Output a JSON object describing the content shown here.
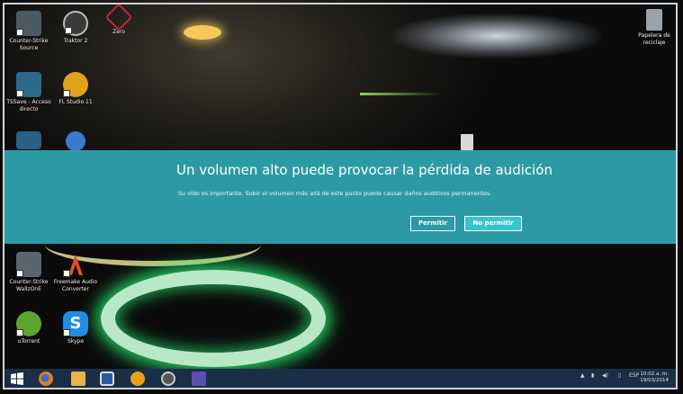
{
  "desktop": {
    "icons": [
      {
        "label": "Counter-Strike Source",
        "icon": "counter-strike-icon",
        "color": "#4d5a66"
      },
      {
        "label": "Traktor 2",
        "icon": "traktor-icon",
        "color": "#3b3b3b"
      },
      {
        "label": "Zero",
        "icon": "zero-app-icon",
        "color": "#c0273a"
      },
      {
        "label": "TSSave - Acceso directo",
        "icon": "tssave-icon",
        "color": "#6dbb3a"
      },
      {
        "label": "FL Studio 11",
        "icon": "fl-studio-icon",
        "color": "#e0a21a"
      },
      {
        "label": "Counter-Strike WallzOnE",
        "icon": "counter-strike-wallz-icon",
        "color": "#5a6570"
      },
      {
        "label": "Freemake Audio Converter",
        "icon": "freemake-icon",
        "color": "#e0502a"
      },
      {
        "label": "uTorrent",
        "icon": "utorrent-icon",
        "color": "#5aa631"
      },
      {
        "label": "Skype",
        "icon": "skype-icon",
        "color": "#1d8ee0"
      }
    ],
    "recycle_bin": {
      "label": "Papelera de reciclaje",
      "icon": "recycle-bin-icon"
    }
  },
  "notification": {
    "title": "Un volumen alto puede provocar la pérdida de audición",
    "message": "Su oído es importante. Subir el volumen más allá de este punto puede causar daños auditivos permanentes.",
    "allow_label": "Permitir",
    "deny_label": "No permitir",
    "background": "#2c9aa5",
    "deny_background": "#37c4cf"
  },
  "taskbar": {
    "apps": [
      {
        "name": "start",
        "icon": "windows-logo-icon"
      },
      {
        "name": "firefox",
        "icon": "firefox-icon"
      },
      {
        "name": "explorer",
        "icon": "file-explorer-icon"
      },
      {
        "name": "clock-app",
        "icon": "clock-app-icon"
      },
      {
        "name": "browser",
        "icon": "globe-browser-icon"
      },
      {
        "name": "traktor",
        "icon": "traktor-taskbar-icon"
      },
      {
        "name": "settings",
        "icon": "gear-icon"
      }
    ],
    "tray": {
      "language": "ESP"
    },
    "clock": {
      "time": "10:02 a. m.",
      "date": "19/03/2014"
    }
  }
}
